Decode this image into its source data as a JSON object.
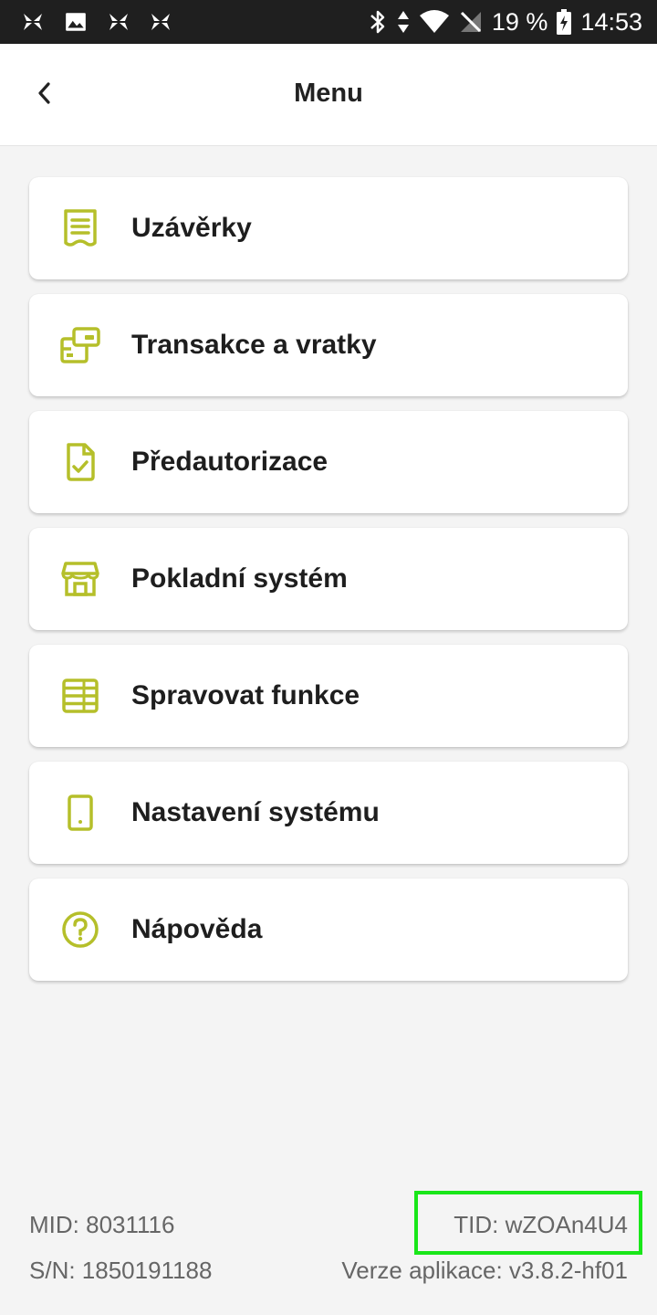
{
  "status_bar": {
    "battery": "19 %",
    "time": "14:53",
    "icons": [
      "app-notification-icon",
      "image-icon",
      "app-notification-icon",
      "app-notification-icon",
      "bluetooth-icon",
      "data-transfer-icon",
      "wifi-icon",
      "no-signal-icon",
      "battery-charging-icon"
    ]
  },
  "header": {
    "title": "Menu"
  },
  "menu": {
    "items": [
      {
        "label": "Uzávěrky",
        "icon": "receipt-icon"
      },
      {
        "label": "Transakce a vratky",
        "icon": "transactions-icon"
      },
      {
        "label": "Předautorizace",
        "icon": "document-check-icon"
      },
      {
        "label": "Pokladní systém",
        "icon": "store-icon"
      },
      {
        "label": "Spravovat funkce",
        "icon": "stack-icon"
      },
      {
        "label": "Nastavení systému",
        "icon": "phone-icon"
      },
      {
        "label": "Nápověda",
        "icon": "help-icon"
      }
    ]
  },
  "footer": {
    "mid": "MID:  8031116",
    "tid": "TID:  wZOAn4U4",
    "sn": "S/N: 1850191188",
    "version": "Verze aplikace: v3.8.2-hf01"
  },
  "colors": {
    "accent": "#b5bf2a",
    "highlight": "#19e619"
  }
}
